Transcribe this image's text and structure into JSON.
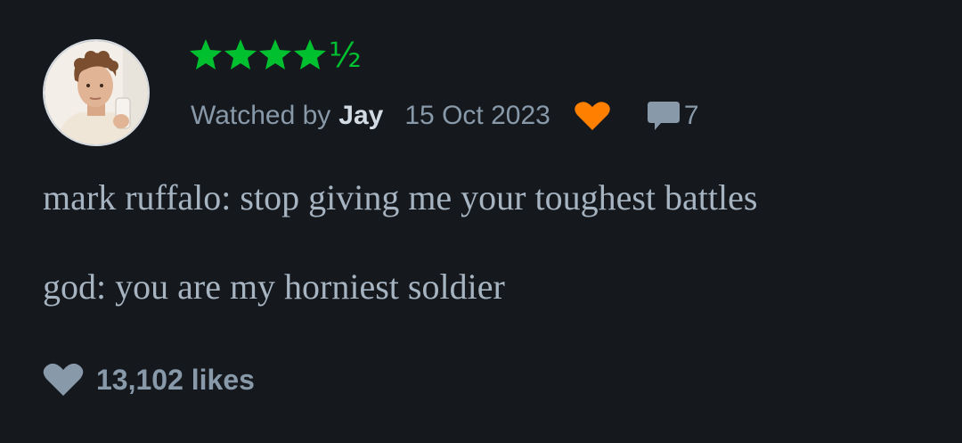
{
  "review": {
    "rating": {
      "stars": 4.5,
      "half_glyph": "½"
    },
    "meta": {
      "watched_prefix": "Watched by",
      "user": "Jay",
      "date": "15 Oct 2023",
      "comment_count": "7"
    },
    "body": {
      "line1": "mark ruffalo: stop giving me your toughest battles",
      "line2": "god: you are my horniest soldier"
    },
    "likes_text": "13,102 likes"
  },
  "colors": {
    "background": "#15181d",
    "star_green": "#00c030",
    "liked_heart_orange": "#ff8000",
    "muted_text": "#8899aa",
    "body_text": "#a6b4c2",
    "username": "#d2dbe4"
  },
  "icons": {
    "star": "star-icon",
    "liked": "heart-icon",
    "comments": "comment-icon",
    "likes": "heart-icon"
  }
}
